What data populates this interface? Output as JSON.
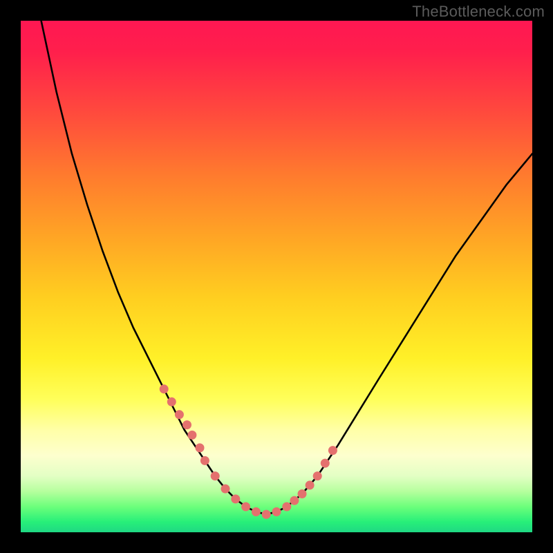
{
  "watermark": {
    "text": "TheBottleneck.com"
  },
  "colors": {
    "frame": "#000000",
    "curve": "#000000",
    "dot_fill": "#e4716e",
    "watermark": "#5b5b5b"
  },
  "chart_data": {
    "type": "line",
    "title": "",
    "xlabel": "",
    "ylabel": "",
    "xlim": [
      0,
      100
    ],
    "ylim": [
      0,
      100
    ],
    "grid": false,
    "legend": false,
    "series": [
      {
        "name": "bottleneck-curve",
        "x": [
          4,
          7,
          10,
          13,
          16,
          19,
          22,
          25,
          28,
          30,
          32,
          34,
          36,
          38,
          40,
          42,
          44,
          46,
          48,
          50,
          52,
          55,
          58,
          62,
          66,
          70,
          75,
          80,
          85,
          90,
          95,
          100
        ],
        "y_pct_from_top": [
          0,
          14,
          26,
          36,
          45,
          53,
          60,
          66,
          72,
          76,
          80,
          83,
          86,
          89,
          91.5,
          93.5,
          95,
          96,
          96.5,
          96,
          95,
          92.5,
          89,
          83,
          76.5,
          70,
          62,
          54,
          46,
          39,
          32,
          26
        ]
      }
    ],
    "dots": {
      "name": "highlight-dots",
      "x": [
        28,
        29.5,
        31,
        32.5,
        33.5,
        35,
        36,
        38,
        40,
        42,
        44,
        46,
        48,
        50,
        52,
        53.5,
        55,
        56.5,
        58,
        59.5,
        61
      ],
      "y_pct_from_top": [
        72,
        74.5,
        77,
        79,
        81,
        83.5,
        86,
        89,
        91.5,
        93.5,
        95,
        96,
        96.5,
        96,
        95,
        93.8,
        92.5,
        90.8,
        89,
        86.5,
        84
      ],
      "r": 6.5
    },
    "note": "y values are expressed as percent from the TOP of the plot area (0 = top, 100 = bottom), estimated visually from the image."
  }
}
